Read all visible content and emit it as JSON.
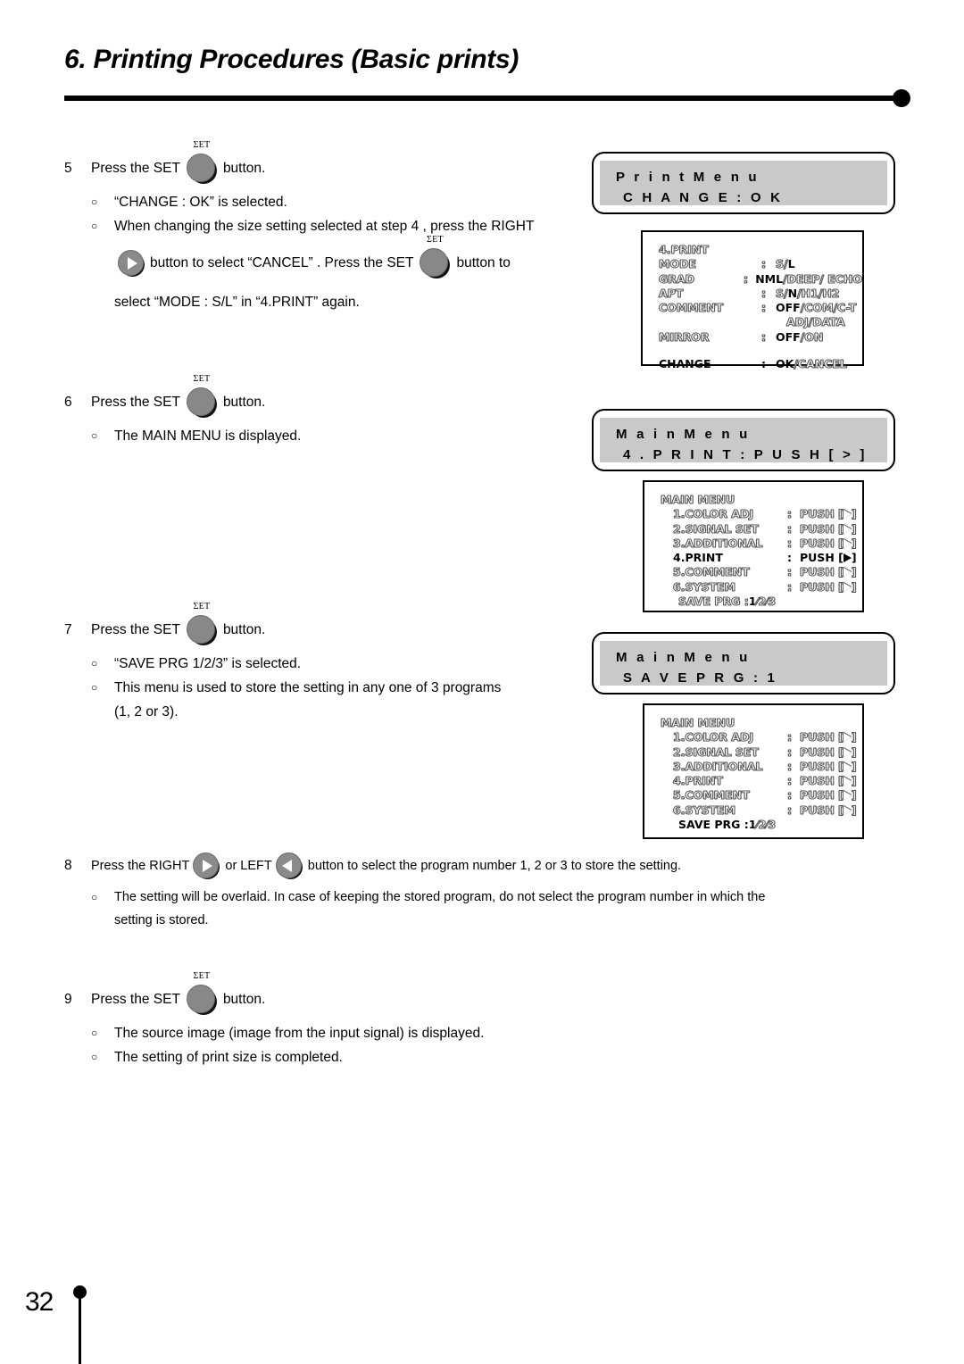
{
  "header": {
    "title": "6. Printing Procedures (Basic prints)"
  },
  "footer": {
    "page_number": "32"
  },
  "button_labels": {
    "set_cap": "ΣET"
  },
  "steps": [
    {
      "number": "5",
      "lead_before": "Press the SET",
      "lead_after": "button.",
      "bullet_mark": "○",
      "bullets": [
        "“CHANGE   : OK” is selected.",
        "When changing the size setting selected at step 4  , press the RIGHT"
      ],
      "cont_a": "button  to select “CANCEL” .  Press the SET",
      "cont_b": "button  to",
      "cont_c": "select “MODE : S/L” in “4.PRINT” again."
    },
    {
      "number": "6",
      "lead_before": "Press the SET",
      "lead_after": "button.",
      "bullet_mark": "○",
      "bullets": [
        "The MAIN MENU is displayed."
      ]
    },
    {
      "number": "7",
      "lead_before": "Press the SET",
      "lead_after": "button.",
      "bullet_mark": "○",
      "bullets": [
        "“SAVE  PRG  1/2/3”  is selected.",
        "This menu is used to store the setting in any one of 3 programs",
        "(1, 2 or 3)."
      ]
    },
    {
      "number": "8",
      "lead_before": "Press the RIGHT",
      "lead_mid": "or LEFT",
      "lead_after": "button  to select the program number 1, 2 or 3  to store the setting.",
      "bullet_mark": "○",
      "bullets": [
        "The setting will be overlaid.  In case of keeping the stored program, do not select the program number in which the",
        "setting is stored."
      ]
    },
    {
      "number": "9",
      "lead_before": "Press the SET",
      "lead_after": "button.",
      "bullet_mark": "○",
      "bullets": [
        "The source image (image from the input signal) is displayed.",
        "The setting of print size is completed."
      ]
    }
  ],
  "captions": [
    {
      "line1": "P r i n t  M e n u",
      "line2": "C H A N G E :  O K"
    },
    {
      "line1": "M a i n  M e n u",
      "line2": "4 . P R I N T    : P U S H [ > ]"
    },
    {
      "line1": "M a i n  M e n u",
      "line2": "S A V E  P R G :  1"
    }
  ],
  "lcd_print": {
    "title": "4.PRINT",
    "rows": [
      {
        "label": "MODE",
        "colon": ":",
        "value_sel": "",
        "value_pre": "S/",
        "value_mid": "L",
        "selected": false
      },
      {
        "label": "GRAD",
        "colon": ":",
        "value_sel": "NML",
        "value_rest": "/DEEP/ ECHO"
      },
      {
        "label": "APT",
        "colon": ":",
        "value_pre": "S/",
        "value_mid": "N",
        "value_rest": "/H1/H2"
      },
      {
        "label": "COMMENT",
        "colon": ":",
        "value_sel": "OFF",
        "value_rest": "/COM/C-T"
      },
      {
        "label": "",
        "colon": "",
        "value_rest": "ADJ/DATA"
      },
      {
        "label": "MIRROR",
        "colon": ":",
        "value_sel": "OFF",
        "value_rest": "/ON"
      }
    ],
    "change_label": "CHANGE",
    "change_colon": ":",
    "change_sel": "OK",
    "change_rest": "/CANCEL"
  },
  "lcd_main_print": {
    "title": "MAIN MENU",
    "items": [
      {
        "label": "1.COLOR ADJ",
        "colon": ":",
        "action": "PUSH",
        "selected": false
      },
      {
        "label": "2.SIGNAL  SET",
        "colon": ":",
        "action": "PUSH",
        "selected": false
      },
      {
        "label": "3.ADDITIONAL",
        "colon": ":",
        "action": "PUSH",
        "selected": false
      },
      {
        "label": "4.PRINT",
        "colon": ":",
        "action": "PUSH",
        "selected": true
      },
      {
        "label": "5.COMMENT",
        "colon": ":",
        "action": "PUSH",
        "selected": false
      },
      {
        "label": "6.SYSTEM",
        "colon": ":",
        "action": "PUSH",
        "selected": false
      }
    ],
    "save_label": "SAVE PRG :",
    "save_sel": "1",
    "save_rest": "⁄2⁄3",
    "save_selected": false
  },
  "lcd_main_save": {
    "title": "MAIN MENU",
    "items": [
      {
        "label": "1.COLOR ADJ",
        "colon": ":",
        "action": "PUSH",
        "selected": false
      },
      {
        "label": "2.SIGNAL  SET",
        "colon": ":",
        "action": "PUSH",
        "selected": false
      },
      {
        "label": "3.ADDITIONAL",
        "colon": ":",
        "action": "PUSH",
        "selected": false
      },
      {
        "label": "4.PRINT",
        "colon": ":",
        "action": "PUSH",
        "selected": false
      },
      {
        "label": "5.COMMENT",
        "colon": ":",
        "action": "PUSH",
        "selected": false
      },
      {
        "label": "6.SYSTEM",
        "colon": ":",
        "action": "PUSH",
        "selected": false
      }
    ],
    "save_label": "SAVE PRG :",
    "save_sel": "1",
    "save_rest": "⁄2⁄3",
    "save_selected": true
  },
  "colors": {
    "button_face": "#888888",
    "button_shadow": "#111111",
    "caption_band": "#c9c9c9",
    "ink": "#000000"
  }
}
